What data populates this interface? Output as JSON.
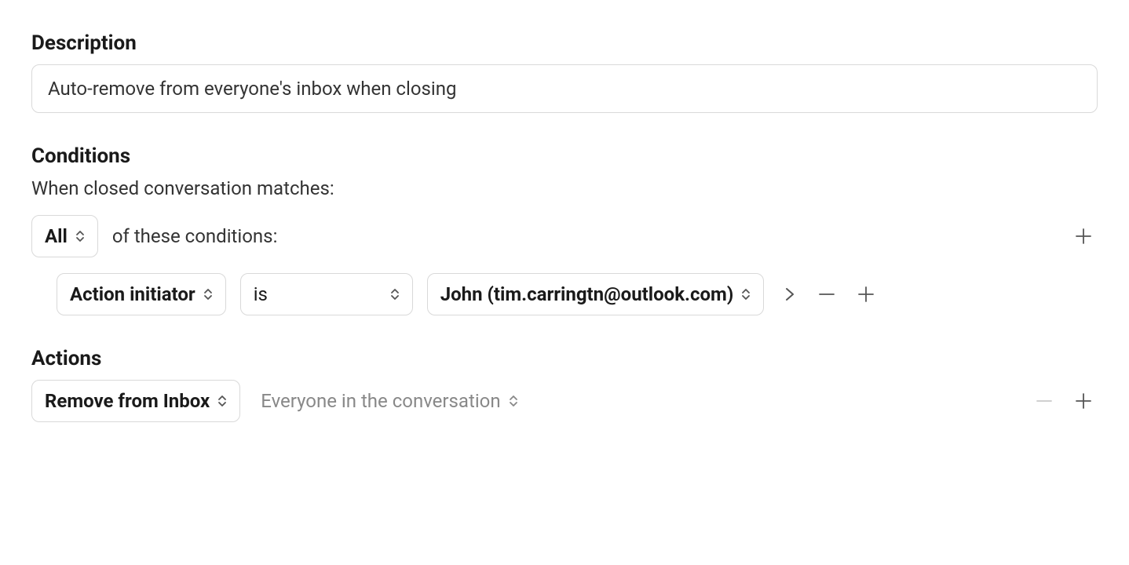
{
  "description": {
    "title": "Description",
    "input_value": "Auto-remove from everyone's inbox when closing"
  },
  "conditions": {
    "title": "Conditions",
    "subtext": "When closed conversation matches:",
    "match_mode": "All",
    "match_suffix": "of these conditions:",
    "rows": [
      {
        "field": "Action initiator",
        "operator": "is",
        "value": "John (tim.carringtn@outlook.com)"
      }
    ]
  },
  "actions": {
    "title": "Actions",
    "rows": [
      {
        "action_type": "Remove from Inbox",
        "target": "Everyone in the conversation"
      }
    ]
  }
}
